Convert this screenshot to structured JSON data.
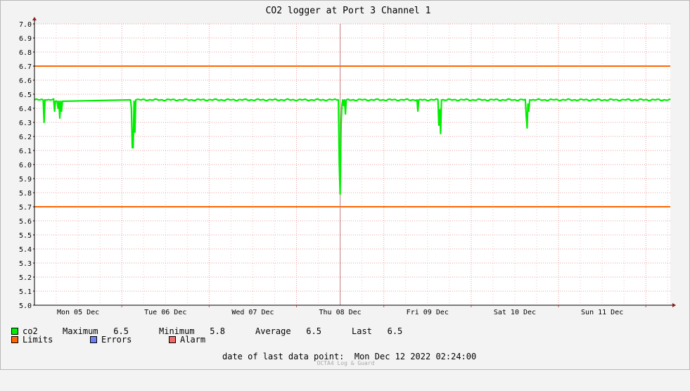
{
  "chart_data": {
    "type": "line",
    "title": "CO2 logger at Port 3 Channel 1",
    "ylim": [
      5.0,
      7.0
    ],
    "yticks": [
      "7.0",
      "6.9",
      "6.8",
      "6.7",
      "6.6",
      "6.5",
      "6.4",
      "6.3",
      "6.2",
      "6.1",
      "6.0",
      "5.9",
      "5.8",
      "5.7",
      "5.6",
      "5.5",
      "5.4",
      "5.3",
      "5.2",
      "5.1",
      "5.0"
    ],
    "xlim_days": [
      0,
      7.28
    ],
    "xticks": [
      {
        "label": "Mon 05 Dec",
        "day": 0.5
      },
      {
        "label": "Tue 06 Dec",
        "day": 1.5
      },
      {
        "label": "Wed 07 Dec",
        "day": 2.5
      },
      {
        "label": "Thu 08 Dec",
        "day": 3.5
      },
      {
        "label": "Fri 09 Dec",
        "day": 4.5
      },
      {
        "label": "Sat 10 Dec",
        "day": 5.5
      },
      {
        "label": "Sun 11 Dec",
        "day": 6.5
      }
    ],
    "grid": true,
    "limits": [
      6.7,
      5.7
    ],
    "marker_day": 3.5,
    "series": [
      {
        "name": "co2",
        "color": "#00ee00",
        "baseline": 6.46,
        "points": [
          [
            0.0,
            6.46
          ],
          [
            0.1,
            6.46
          ],
          [
            0.11,
            6.3
          ],
          [
            0.12,
            6.46
          ],
          [
            0.22,
            6.46
          ],
          [
            0.23,
            6.38
          ],
          [
            0.24,
            6.45
          ],
          [
            0.26,
            6.45
          ],
          [
            0.27,
            6.4
          ],
          [
            0.28,
            6.45
          ],
          [
            0.29,
            6.33
          ],
          [
            0.3,
            6.45
          ],
          [
            0.31,
            6.38
          ],
          [
            0.32,
            6.45
          ],
          [
            1.1,
            6.46
          ],
          [
            1.11,
            6.4
          ],
          [
            1.12,
            6.12
          ],
          [
            1.13,
            6.12
          ],
          [
            1.14,
            6.45
          ],
          [
            1.15,
            6.23
          ],
          [
            1.16,
            6.46
          ],
          [
            3.48,
            6.46
          ],
          [
            3.49,
            6.0
          ],
          [
            3.5,
            5.79
          ],
          [
            3.51,
            6.28
          ],
          [
            3.52,
            6.42
          ],
          [
            3.53,
            6.46
          ],
          [
            3.54,
            6.42
          ],
          [
            3.55,
            6.46
          ],
          [
            3.56,
            6.36
          ],
          [
            3.57,
            6.46
          ],
          [
            4.38,
            6.46
          ],
          [
            4.39,
            6.38
          ],
          [
            4.4,
            6.46
          ],
          [
            4.62,
            6.46
          ],
          [
            4.63,
            6.28
          ],
          [
            4.64,
            6.39
          ],
          [
            4.65,
            6.22
          ],
          [
            4.66,
            6.46
          ],
          [
            5.62,
            6.46
          ],
          [
            5.63,
            6.35
          ],
          [
            5.64,
            6.26
          ],
          [
            5.65,
            6.43
          ],
          [
            5.66,
            6.38
          ],
          [
            5.67,
            6.46
          ],
          [
            7.28,
            6.46
          ]
        ]
      }
    ],
    "legend": {
      "series_name": "co2",
      "stats": {
        "maximum_label": "Maximum",
        "maximum": "6.5",
        "minimum_label": "Minimum",
        "minimum": "5.8",
        "average_label": "Average",
        "average": "6.5",
        "last_label": "Last",
        "last": "6.5"
      },
      "others": [
        {
          "name": "Limits",
          "color": "#ff6600"
        },
        {
          "name": "Errors",
          "color": "#6f7ff5"
        },
        {
          "name": "Alarm",
          "color": "#f06a6a"
        }
      ]
    }
  },
  "footer": {
    "last_point_label": "date of last data point:",
    "last_point_value": "Mon Dec 12 2022 02:24:00",
    "credit": "OCTA4 Log & Guard"
  },
  "colors": {
    "background": "#f3f3f3",
    "plot_background": "#ffffff",
    "grid": "#e8a0a0",
    "limits": "#ff6600",
    "marker": "#c08080",
    "axis": "#000000",
    "arrow": "#8b1a1a"
  }
}
